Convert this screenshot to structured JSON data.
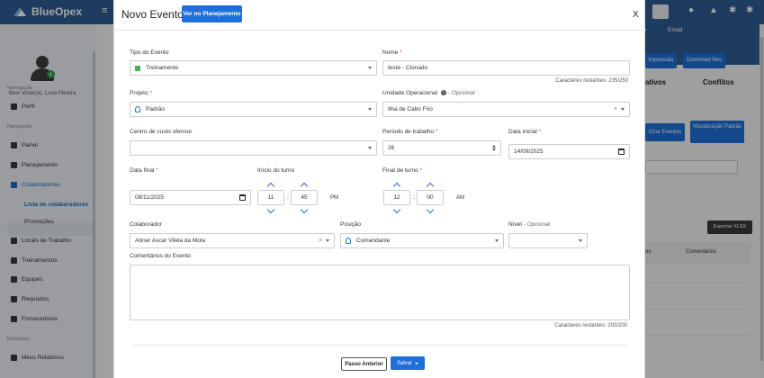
{
  "app": {
    "brand": "BlueOpex",
    "topbar_email": "Email",
    "welcome": "Bem Vindo(a), Luna Pereira",
    "sidebar": {
      "section_navigation_top": "Navegação",
      "perfil": "Perfil",
      "section_navigation": "Navegação",
      "items": [
        "Painel",
        "Planejamento",
        "Colaboradores"
      ],
      "sub_items": [
        "Lista de colaboradores",
        "Promoções"
      ],
      "items2": [
        "Locais de Trabalho",
        "Treinamentos",
        "Equipes",
        "Requisitos",
        "Fornecedores"
      ],
      "section_reports": "Relatórios",
      "reports": [
        "Meus Relatórios"
      ]
    },
    "background": {
      "impressao": "Impressão",
      "download": "Download files",
      "ativos": "ativos",
      "conflitos": "Conflitos",
      "criar_eventos": "Criar Eventos",
      "visualizacao": "Visualização Padrão",
      "exportar": "Exportar XLSX",
      "th_col1": "os",
      "th_col2": "Comentários"
    }
  },
  "modal": {
    "title": "Novo Evento",
    "plan_button": "Ver no Planejamento",
    "close": "X",
    "tipo_evento": {
      "label": "Tipo do Evento",
      "value": "Treinamento"
    },
    "nome": {
      "label": "Nome",
      "value": "teste - Clonado",
      "hint": "Caracteres restantes: 235/250"
    },
    "projeto": {
      "label": "Projeto",
      "value": "Padrão"
    },
    "unidade": {
      "label": "Unidade Operacional",
      "optional": "- Opcional",
      "value": "Ilha de Cabo Frio"
    },
    "centro_custo": {
      "label": "Centro de custo ofensor",
      "value": ""
    },
    "periodo": {
      "label": "Período de trabalho",
      "value": "26"
    },
    "data_inicial": {
      "label": "Data inicial",
      "value": "14/09/2025"
    },
    "data_final": {
      "label": "Data final",
      "value": "08/11/2025"
    },
    "inicio_turno": {
      "label": "Início do turno",
      "hour": "11",
      "minute": "45",
      "period": "PM"
    },
    "final_turno": {
      "label": "Final de turno",
      "hour": "12",
      "minute": "00",
      "period": "AM"
    },
    "colaborador": {
      "label": "Colaborador",
      "value": "Abner Ascar Vilela da Mota"
    },
    "posicao": {
      "label": "Posição",
      "value": "Comandante"
    },
    "nivel": {
      "label": "Nível",
      "optional": "- Opcional",
      "value": ""
    },
    "comentarios": {
      "label": "Comentários do Evento",
      "hint": "Caracteres restantes: 200/200"
    },
    "buttons": {
      "previous": "Passo Anterior",
      "save": "Salvar"
    }
  },
  "colors": {
    "primary": "#1e6fd9",
    "topbar": "#2f5b94",
    "required": "#d9534f",
    "training": "#4caf50"
  }
}
